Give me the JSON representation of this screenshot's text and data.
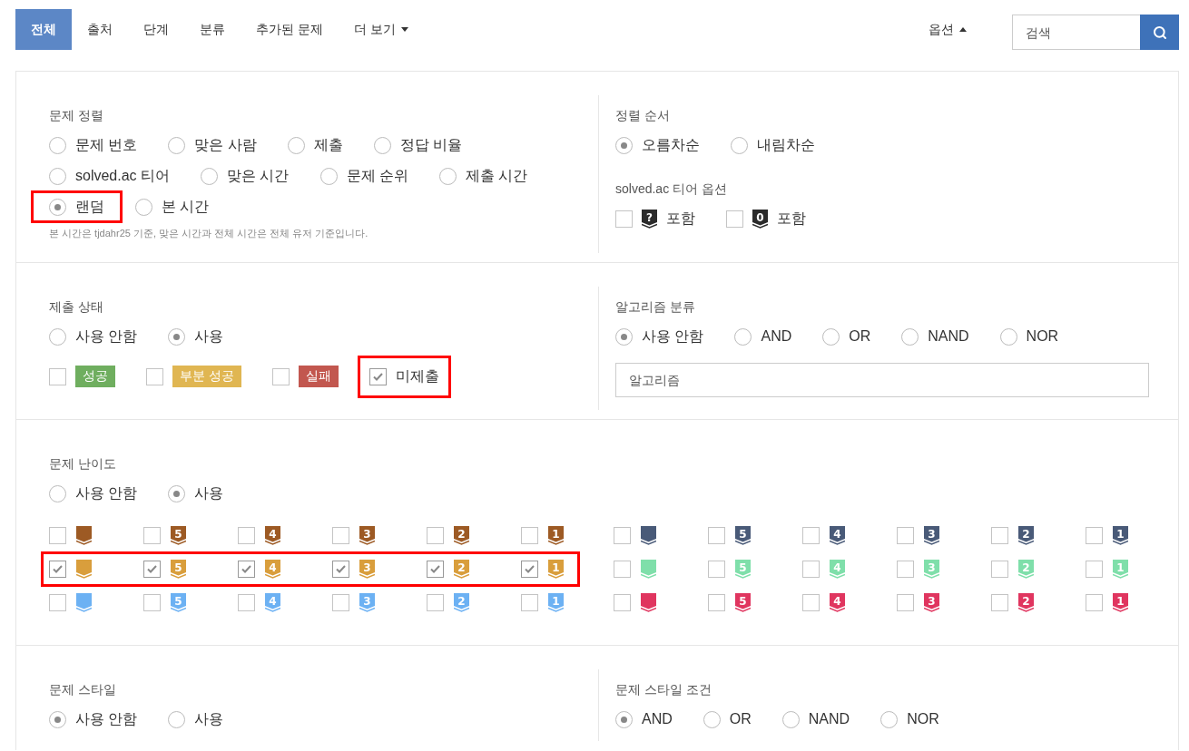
{
  "nav": {
    "tabs": [
      {
        "label": "전체",
        "selected": true
      },
      {
        "label": "출처",
        "selected": false
      },
      {
        "label": "단계",
        "selected": false
      },
      {
        "label": "분류",
        "selected": false
      },
      {
        "label": "추가된 문제",
        "selected": false
      },
      {
        "label": "더 보기",
        "selected": false,
        "dropdown": true
      }
    ],
    "options": {
      "label": "옵션",
      "expanded": true
    },
    "search": {
      "placeholder": "검색"
    }
  },
  "sort": {
    "title": "문제 정렬",
    "options": [
      {
        "label": "문제 번호",
        "selected": false,
        "highlighted": false
      },
      {
        "label": "맞은 사람",
        "selected": false,
        "highlighted": false
      },
      {
        "label": "제출",
        "selected": false,
        "highlighted": false
      },
      {
        "label": "정답 비율",
        "selected": false,
        "highlighted": false
      },
      {
        "label": "solved.ac 티어",
        "selected": false,
        "highlighted": false
      },
      {
        "label": "맞은 시간",
        "selected": false,
        "highlighted": false
      },
      {
        "label": "문제 순위",
        "selected": false,
        "highlighted": false
      },
      {
        "label": "제출 시간",
        "selected": false,
        "highlighted": false
      },
      {
        "label": "랜덤",
        "selected": true,
        "highlighted": true
      },
      {
        "label": "본 시간",
        "selected": false,
        "highlighted": false
      }
    ],
    "note": "본 시간은 tjdahr25 기준, 맞은 시간과 전체 시간은 전체 유저 기준입니다."
  },
  "order": {
    "title": "정렬 순서",
    "options": [
      {
        "label": "오름차순",
        "selected": true
      },
      {
        "label": "내림차순",
        "selected": false
      }
    ]
  },
  "tier_options": {
    "title": "solved.ac 티어 옵션",
    "items": [
      {
        "badge": "?",
        "label": "포함",
        "checked": false
      },
      {
        "badge": "0",
        "label": "포함",
        "checked": false
      }
    ]
  },
  "status": {
    "title": "제출 상태",
    "options": [
      {
        "label": "사용 안함",
        "selected": false
      },
      {
        "label": "사용",
        "selected": true
      }
    ],
    "items": [
      {
        "label": "성공",
        "checked": false,
        "color": "#6fae5f",
        "highlighted": false
      },
      {
        "label": "부분 성공",
        "checked": false,
        "color": "#e0b652",
        "highlighted": false
      },
      {
        "label": "실패",
        "checked": false,
        "color": "#c2574f",
        "highlighted": false
      },
      {
        "label": "미제출",
        "checked": true,
        "highlighted": true
      }
    ]
  },
  "algorithm": {
    "title": "알고리즘 분류",
    "options": [
      {
        "label": "사용 안함",
        "selected": true
      },
      {
        "label": "AND",
        "selected": false
      },
      {
        "label": "OR",
        "selected": false
      },
      {
        "label": "NAND",
        "selected": false
      },
      {
        "label": "NOR",
        "selected": false
      }
    ],
    "input": {
      "placeholder": "알고리즘"
    }
  },
  "difficulty": {
    "title": "문제 난이도",
    "options": [
      {
        "label": "사용 안함",
        "selected": false
      },
      {
        "label": "사용",
        "selected": true
      }
    ],
    "tier_groups": [
      {
        "color": "#9d5a24",
        "highlighted": false,
        "items": [
          {
            "checked": false
          },
          {
            "label": "5",
            "checked": false
          },
          {
            "label": "4",
            "checked": false
          },
          {
            "label": "3",
            "checked": false
          },
          {
            "label": "2",
            "checked": false
          },
          {
            "label": "1",
            "checked": false
          }
        ]
      },
      {
        "color": "#495a78",
        "highlighted": false,
        "items": [
          {
            "checked": false
          },
          {
            "label": "5",
            "checked": false
          },
          {
            "label": "4",
            "checked": false
          },
          {
            "label": "3",
            "checked": false
          },
          {
            "label": "2",
            "checked": false
          },
          {
            "label": "1",
            "checked": false
          }
        ]
      },
      {
        "color": "#d99e3c",
        "highlighted": true,
        "items": [
          {
            "checked": true
          },
          {
            "label": "5",
            "checked": true
          },
          {
            "label": "4",
            "checked": true
          },
          {
            "label": "3",
            "checked": true
          },
          {
            "label": "2",
            "checked": true
          },
          {
            "label": "1",
            "checked": true
          }
        ]
      },
      {
        "color": "#7fdfaa",
        "highlighted": false,
        "items": [
          {
            "checked": false
          },
          {
            "label": "5",
            "checked": false
          },
          {
            "label": "4",
            "checked": false
          },
          {
            "label": "3",
            "checked": false
          },
          {
            "label": "2",
            "checked": false
          },
          {
            "label": "1",
            "checked": false
          }
        ]
      },
      {
        "color": "#6cb1f3",
        "highlighted": false,
        "items": [
          {
            "checked": false
          },
          {
            "label": "5",
            "checked": false
          },
          {
            "label": "4",
            "checked": false
          },
          {
            "label": "3",
            "checked": false
          },
          {
            "label": "2",
            "checked": false
          },
          {
            "label": "1",
            "checked": false
          }
        ]
      },
      {
        "color": "#e0355f",
        "highlighted": false,
        "items": [
          {
            "checked": false
          },
          {
            "label": "5",
            "checked": false
          },
          {
            "label": "4",
            "checked": false
          },
          {
            "label": "3",
            "checked": false
          },
          {
            "label": "2",
            "checked": false
          },
          {
            "label": "1",
            "checked": false
          }
        ]
      }
    ]
  },
  "style": {
    "title": "문제 스타일",
    "options": [
      {
        "label": "사용 안함",
        "selected": true
      },
      {
        "label": "사용",
        "selected": false
      }
    ]
  },
  "style_condition": {
    "title": "문제 스타일 조건",
    "options": [
      {
        "label": "AND",
        "selected": true
      },
      {
        "label": "OR",
        "selected": false
      },
      {
        "label": "NAND",
        "selected": false
      },
      {
        "label": "NOR",
        "selected": false
      }
    ]
  }
}
